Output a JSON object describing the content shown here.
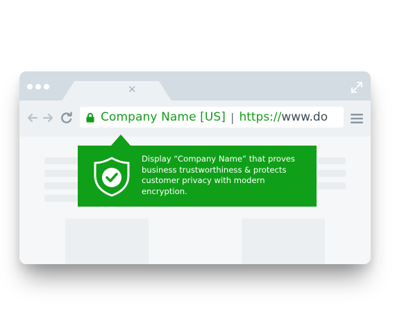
{
  "browser": {
    "tab": {
      "close_icon": "close-icon"
    },
    "window_controls": [
      "dot",
      "dot",
      "dot"
    ],
    "toolbar": {
      "back_icon": "arrow-left-icon",
      "forward_icon": "arrow-right-icon",
      "reload_icon": "reload-icon",
      "menu_icon": "hamburger-menu-icon"
    },
    "address_bar": {
      "lock_icon": "lock-icon",
      "company_name": "Company Name [US]",
      "separator": "|",
      "url_secure": "https://",
      "url_host": "www.do"
    }
  },
  "tooltip": {
    "icon": "shield-check-icon",
    "text": "Display “Company Name” that proves business trustworthiness & protects customer privacy with modern encryption."
  },
  "colors": {
    "green": "#109f18",
    "ev_text_green": "#169b1d",
    "titlebar": "#d3dce3",
    "toolbar": "#eef1f4"
  }
}
